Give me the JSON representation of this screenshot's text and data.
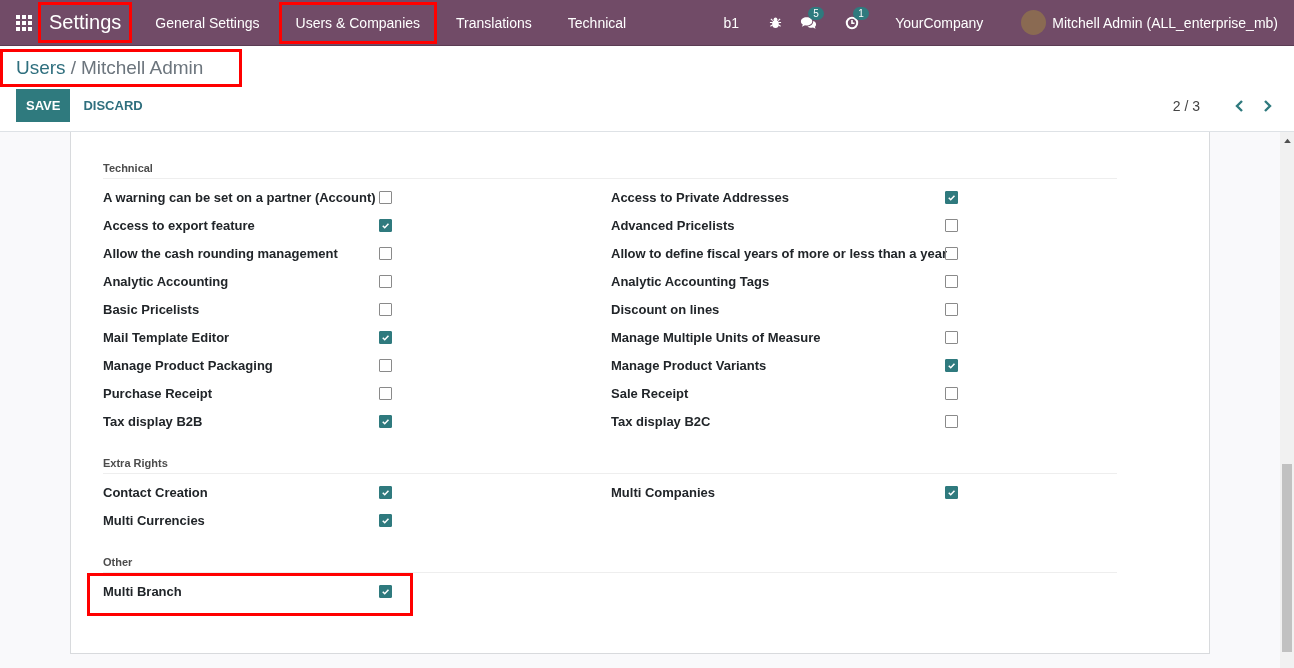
{
  "navbar": {
    "brand": {
      "label": "Settings",
      "highlighted": true
    },
    "menu": [
      {
        "label": "General Settings",
        "highlighted": false
      },
      {
        "label": "Users & Companies",
        "highlighted": true
      },
      {
        "label": "Translations",
        "highlighted": false
      },
      {
        "label": "Technical",
        "highlighted": false
      }
    ],
    "branch": "b1",
    "messages_badge": "5",
    "activities_badge": "1",
    "company": "YourCompany",
    "user": "Mitchell Admin (ALL_enterprise_mb)"
  },
  "breadcrumb": {
    "parent": "Users",
    "separator": "/",
    "current": "Mitchell Admin",
    "highlighted": true
  },
  "buttons": {
    "save": "SAVE",
    "discard": "DISCARD"
  },
  "pager": "2 / 3",
  "sections": [
    {
      "title": "Technical",
      "items": [
        {
          "label": "A warning can be set on a partner (Account)",
          "checked": false,
          "highlighted": false
        },
        {
          "label": "Access to Private Addresses",
          "checked": true,
          "highlighted": false
        },
        {
          "label": "Access to export feature",
          "checked": true,
          "highlighted": false
        },
        {
          "label": "Advanced Pricelists",
          "checked": false,
          "highlighted": false
        },
        {
          "label": "Allow the cash rounding management",
          "checked": false,
          "highlighted": false
        },
        {
          "label": "Allow to define fiscal years of more or less than a year",
          "checked": false,
          "highlighted": false
        },
        {
          "label": "Analytic Accounting",
          "checked": false,
          "highlighted": false
        },
        {
          "label": "Analytic Accounting Tags",
          "checked": false,
          "highlighted": false
        },
        {
          "label": "Basic Pricelists",
          "checked": false,
          "highlighted": false
        },
        {
          "label": "Discount on lines",
          "checked": false,
          "highlighted": false
        },
        {
          "label": "Mail Template Editor",
          "checked": true,
          "highlighted": false
        },
        {
          "label": "Manage Multiple Units of Measure",
          "checked": false,
          "highlighted": false
        },
        {
          "label": "Manage Product Packaging",
          "checked": false,
          "highlighted": false
        },
        {
          "label": "Manage Product Variants",
          "checked": true,
          "highlighted": false
        },
        {
          "label": "Purchase Receipt",
          "checked": false,
          "highlighted": false
        },
        {
          "label": "Sale Receipt",
          "checked": false,
          "highlighted": false
        },
        {
          "label": "Tax display B2B",
          "checked": true,
          "highlighted": false
        },
        {
          "label": "Tax display B2C",
          "checked": false,
          "highlighted": false
        }
      ]
    },
    {
      "title": "Extra Rights",
      "items": [
        {
          "label": "Contact Creation",
          "checked": true,
          "highlighted": false
        },
        {
          "label": "Multi Companies",
          "checked": true,
          "highlighted": false
        },
        {
          "label": "Multi Currencies",
          "checked": true,
          "highlighted": false
        }
      ]
    },
    {
      "title": "Other",
      "items": [
        {
          "label": "Multi Branch",
          "checked": true,
          "highlighted": true
        }
      ]
    }
  ]
}
